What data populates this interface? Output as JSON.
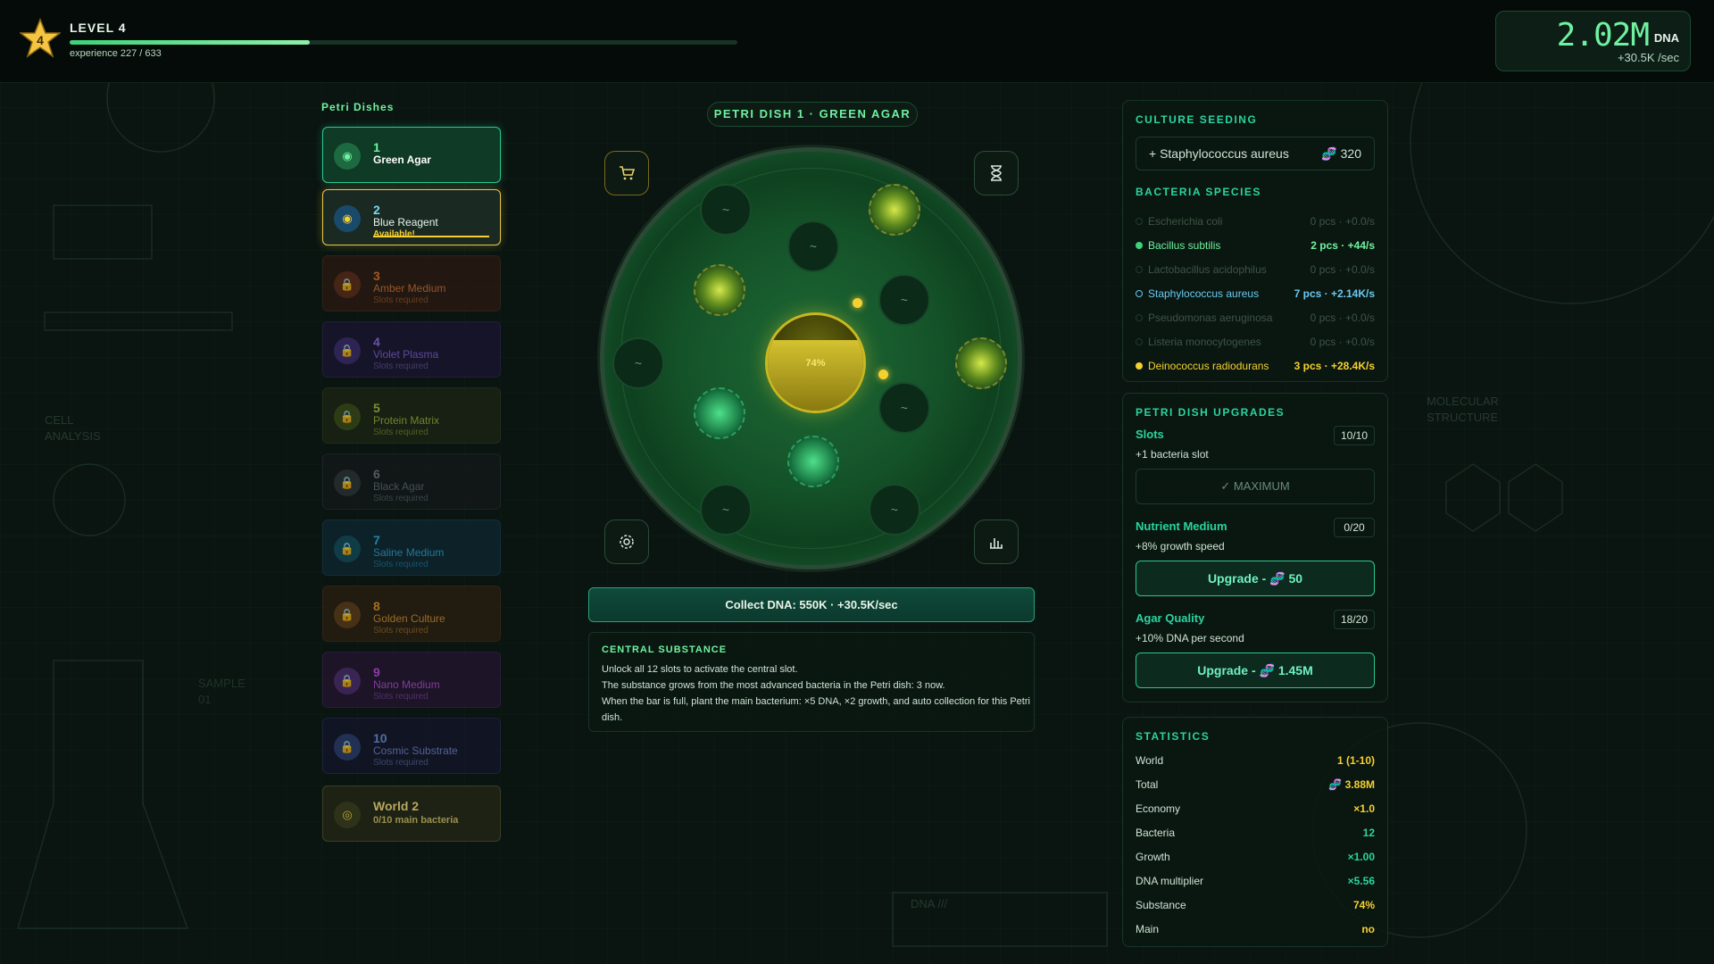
{
  "header": {
    "level_label": "LEVEL 4",
    "level_badge": "4",
    "experience_text": "experience 227 / 633",
    "experience_progress": 0.359,
    "dna_value": "2.02M",
    "dna_unit": "DNA",
    "dna_rate": "+30.5K /sec"
  },
  "dishes": {
    "title": "Petri Dishes",
    "items": [
      {
        "num": "1",
        "name": "Green Agar",
        "sub": ""
      },
      {
        "num": "2",
        "name": "Blue Reagent",
        "sub": "Available!"
      },
      {
        "num": "3",
        "name": "Amber Medium",
        "sub": "Slots required"
      },
      {
        "num": "4",
        "name": "Violet Plasma",
        "sub": "Slots required"
      },
      {
        "num": "5",
        "name": "Protein Matrix",
        "sub": "Slots required"
      },
      {
        "num": "6",
        "name": "Black Agar",
        "sub": "Slots required"
      },
      {
        "num": "7",
        "name": "Saline Medium",
        "sub": "Slots required"
      },
      {
        "num": "8",
        "name": "Golden Culture",
        "sub": "Slots required"
      },
      {
        "num": "9",
        "name": "Nano Medium",
        "sub": "Slots required"
      },
      {
        "num": "10",
        "name": "Cosmic Substrate",
        "sub": "Slots required"
      }
    ],
    "world_next": {
      "title": "World 2",
      "sub": "0/10 main bacteria"
    }
  },
  "center": {
    "dish_title": "PETRI DISH 1 · GREEN AGAR",
    "substance_pct": "74%",
    "substance_level": 0.74,
    "collect_label": "Collect DNA: 550K · +30.5K/sec",
    "central_title": "CENTRAL SUBSTANCE",
    "central_line1": "Unlock all 12 slots to activate the central slot.",
    "central_line2": "The substance grows from the most advanced bacteria in the Petri dish: 3 now.",
    "central_line3": "When the bar is full, plant the main bacterium: ×5 DNA, ×2 growth, and auto collection for this Petri dish."
  },
  "seeding": {
    "title": "CULTURE SEEDING",
    "seed_label": "+ Staphylococcus aureus",
    "seed_cost": "320",
    "species_title": "BACTERIA SPECIES",
    "species": [
      {
        "name": "Escherichia coli",
        "value": "0 pcs · +0.0/s",
        "state": "off"
      },
      {
        "name": "Bacillus subtilis",
        "value": "2 pcs · +44/s",
        "state": "green"
      },
      {
        "name": "Lactobacillus acidophilus",
        "value": "0 pcs · +0.0/s",
        "state": "off"
      },
      {
        "name": "Staphylococcus aureus",
        "value": "7 pcs · +2.14K/s",
        "state": "blue"
      },
      {
        "name": "Pseudomonas aeruginosa",
        "value": "0 pcs · +0.0/s",
        "state": "off"
      },
      {
        "name": "Listeria monocytogenes",
        "value": "0 pcs · +0.0/s",
        "state": "off"
      },
      {
        "name": "Deinococcus radiodurans",
        "value": "3 pcs · +28.4K/s",
        "state": "yellow"
      }
    ]
  },
  "upgrades": {
    "title": "PETRI DISH UPGRADES",
    "slots_title": "Slots",
    "slots_badge": "10/10",
    "slots_desc": "+1 bacteria slot",
    "slots_max": "✓ MAXIMUM",
    "nutrient_title": "Nutrient Medium",
    "nutrient_badge": "0/20",
    "nutrient_desc": "+8% growth speed",
    "nutrient_btn": "Upgrade - 🧬 50",
    "agar_title": "Agar Quality",
    "agar_badge": "18/20",
    "agar_desc": "+10% DNA per second",
    "agar_btn": "Upgrade - 🧬 1.45M"
  },
  "stats": {
    "title": "STATISTICS",
    "rows": [
      {
        "k": "World",
        "v": "1 (1-10)",
        "c": "#f5d030"
      },
      {
        "k": "Total",
        "v": "🧬 3.88M",
        "c": "#f5d030"
      },
      {
        "k": "Economy",
        "v": "×1.0",
        "c": "#f5d030"
      },
      {
        "k": "Bacteria",
        "v": "12",
        "c": "#2ad4a0"
      },
      {
        "k": "Growth",
        "v": "×1.00",
        "c": "#2ad4a0"
      },
      {
        "k": "DNA multiplier",
        "v": "×5.56",
        "c": "#2ad4a0"
      },
      {
        "k": "Substance",
        "v": "74%",
        "c": "#f5d030"
      },
      {
        "k": "Main",
        "v": "no",
        "c": "#f5d030"
      }
    ]
  },
  "bg_labels": {
    "cell": "CELL",
    "analysis": "ANALYSIS",
    "sample": "SAMPLE",
    "sample_num": "01",
    "molecular": "MOLECULAR",
    "structure": "STRUCTURE",
    "dna": "DNA ///"
  },
  "colors": {
    "accent": "#2ad4a0",
    "gold": "#f5d030",
    "green": "#3ed27a"
  }
}
